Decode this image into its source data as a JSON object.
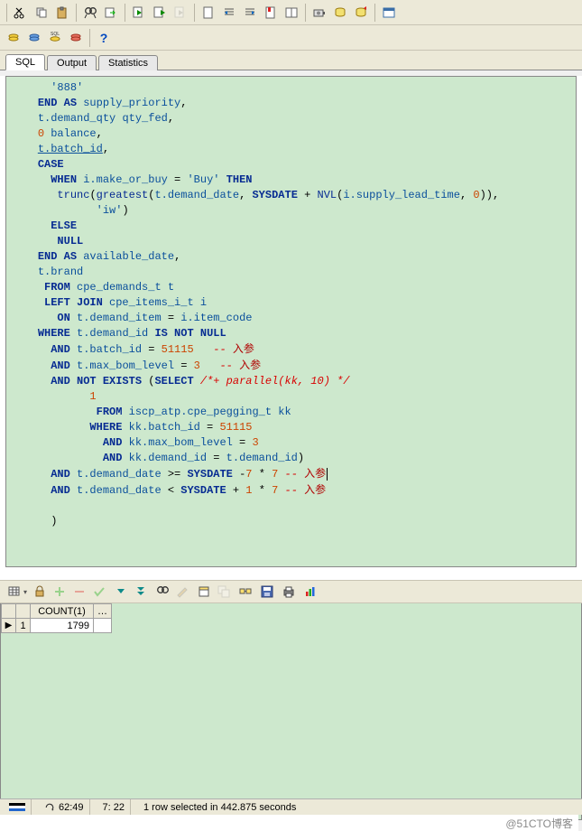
{
  "tabs": {
    "sql": "SQL",
    "output": "Output",
    "statistics": "Statistics"
  },
  "toolbar2": {
    "help_glyph": "?"
  },
  "sql_tokens": [
    {
      "indent": 6,
      "parts": [
        [
          "str",
          "'888'"
        ]
      ]
    },
    {
      "indent": 4,
      "parts": [
        [
          "kw",
          "END AS"
        ],
        [
          "txt",
          " "
        ],
        [
          "id",
          "supply_priority"
        ],
        [
          "txt",
          ","
        ]
      ]
    },
    {
      "indent": 4,
      "parts": [
        [
          "id",
          "t.demand_qty"
        ],
        [
          "txt",
          " "
        ],
        [
          "id",
          "qty_fed"
        ],
        [
          "txt",
          ","
        ]
      ]
    },
    {
      "indent": 4,
      "parts": [
        [
          "num",
          "0"
        ],
        [
          "txt",
          " "
        ],
        [
          "id",
          "balance"
        ],
        [
          "txt",
          ","
        ]
      ]
    },
    {
      "indent": 4,
      "parts": [
        [
          "id ul",
          "t.batch_id"
        ],
        [
          "txt",
          ","
        ]
      ]
    },
    {
      "indent": 4,
      "parts": [
        [
          "kw",
          "CASE"
        ]
      ]
    },
    {
      "indent": 6,
      "parts": [
        [
          "kw",
          "WHEN"
        ],
        [
          "txt",
          " "
        ],
        [
          "id",
          "i.make_or_buy"
        ],
        [
          "txt",
          " = "
        ],
        [
          "str",
          "'Buy'"
        ],
        [
          "txt",
          " "
        ],
        [
          "kw",
          "THEN"
        ]
      ]
    },
    {
      "indent": 7,
      "parts": [
        [
          "fn",
          "trunc"
        ],
        [
          "txt",
          "("
        ],
        [
          "fn",
          "greatest"
        ],
        [
          "txt",
          "("
        ],
        [
          "id",
          "t.demand_date"
        ],
        [
          "txt",
          ", "
        ],
        [
          "kw",
          "SYSDATE"
        ],
        [
          "txt",
          " + "
        ],
        [
          "fn",
          "NVL"
        ],
        [
          "txt",
          "("
        ],
        [
          "id",
          "i.supply_lead_time"
        ],
        [
          "txt",
          ", "
        ],
        [
          "num",
          "0"
        ],
        [
          "txt",
          ")),"
        ]
      ]
    },
    {
      "indent": 13,
      "parts": [
        [
          "str",
          "'iw'"
        ],
        [
          "txt",
          ")"
        ]
      ]
    },
    {
      "indent": 6,
      "parts": [
        [
          "kw",
          "ELSE"
        ]
      ]
    },
    {
      "indent": 7,
      "parts": [
        [
          "kw",
          "NULL"
        ]
      ]
    },
    {
      "indent": 4,
      "parts": [
        [
          "kw",
          "END AS"
        ],
        [
          "txt",
          " "
        ],
        [
          "id",
          "available_date"
        ],
        [
          "txt",
          ","
        ]
      ]
    },
    {
      "indent": 4,
      "parts": [
        [
          "id",
          "t.brand"
        ]
      ]
    },
    {
      "indent": 5,
      "parts": [
        [
          "kw",
          "FROM"
        ],
        [
          "txt",
          " "
        ],
        [
          "id",
          "cpe_demands_t"
        ],
        [
          "txt",
          " "
        ],
        [
          "id",
          "t"
        ]
      ]
    },
    {
      "indent": 5,
      "parts": [
        [
          "kw",
          "LEFT JOIN"
        ],
        [
          "txt",
          " "
        ],
        [
          "id",
          "cpe_items_i_t"
        ],
        [
          "txt",
          " "
        ],
        [
          "id",
          "i"
        ]
      ]
    },
    {
      "indent": 7,
      "parts": [
        [
          "kw",
          "ON"
        ],
        [
          "txt",
          " "
        ],
        [
          "id",
          "t.demand_item"
        ],
        [
          "txt",
          " = "
        ],
        [
          "id",
          "i.item_code"
        ]
      ]
    },
    {
      "indent": 4,
      "parts": [
        [
          "kw",
          "WHERE"
        ],
        [
          "txt",
          " "
        ],
        [
          "id",
          "t.demand_id"
        ],
        [
          "txt",
          " "
        ],
        [
          "kw",
          "IS NOT NULL"
        ]
      ]
    },
    {
      "indent": 6,
      "parts": [
        [
          "kw",
          "AND"
        ],
        [
          "txt",
          " "
        ],
        [
          "id",
          "t.batch_id"
        ],
        [
          "txt",
          " = "
        ],
        [
          "num",
          "51115"
        ],
        [
          "txt",
          "   "
        ],
        [
          "cmt",
          "-- "
        ],
        [
          "cmtcn",
          "入参"
        ]
      ]
    },
    {
      "indent": 6,
      "parts": [
        [
          "kw",
          "AND"
        ],
        [
          "txt",
          " "
        ],
        [
          "id",
          "t.max_bom_level"
        ],
        [
          "txt",
          " = "
        ],
        [
          "num",
          "3"
        ],
        [
          "txt",
          "   "
        ],
        [
          "cmt",
          "-- "
        ],
        [
          "cmtcn",
          "入参"
        ]
      ]
    },
    {
      "indent": 6,
      "parts": [
        [
          "kw",
          "AND NOT EXISTS"
        ],
        [
          "txt",
          " ("
        ],
        [
          "kw",
          "SELECT"
        ],
        [
          "txt",
          " "
        ],
        [
          "cmt",
          "/*+ parallel(kk, 10) */"
        ]
      ]
    },
    {
      "indent": 12,
      "parts": [
        [
          "num",
          "1"
        ]
      ]
    },
    {
      "indent": 13,
      "parts": [
        [
          "kw",
          "FROM"
        ],
        [
          "txt",
          " "
        ],
        [
          "id",
          "iscp_atp.cpe_pegging_t"
        ],
        [
          "txt",
          " "
        ],
        [
          "id",
          "kk"
        ]
      ]
    },
    {
      "indent": 12,
      "parts": [
        [
          "kw",
          "WHERE"
        ],
        [
          "txt",
          " "
        ],
        [
          "id",
          "kk.batch_id"
        ],
        [
          "txt",
          " = "
        ],
        [
          "num",
          "51115"
        ]
      ]
    },
    {
      "indent": 14,
      "parts": [
        [
          "kw",
          "AND"
        ],
        [
          "txt",
          " "
        ],
        [
          "id",
          "kk.max_bom_level"
        ],
        [
          "txt",
          " = "
        ],
        [
          "num",
          "3"
        ]
      ]
    },
    {
      "indent": 14,
      "parts": [
        [
          "kw",
          "AND"
        ],
        [
          "txt",
          " "
        ],
        [
          "id",
          "kk.demand_id"
        ],
        [
          "txt",
          " = "
        ],
        [
          "id",
          "t.demand_id"
        ],
        [
          "txt",
          ")"
        ]
      ]
    },
    {
      "indent": 6,
      "parts": [
        [
          "kw",
          "AND"
        ],
        [
          "txt",
          " "
        ],
        [
          "id",
          "t.demand_date"
        ],
        [
          "txt",
          " >= "
        ],
        [
          "kw",
          "SYSDATE"
        ],
        [
          "txt",
          " -"
        ],
        [
          "num",
          "7"
        ],
        [
          "txt",
          " * "
        ],
        [
          "num",
          "7"
        ],
        [
          "txt",
          " "
        ],
        [
          "cmt",
          "-- "
        ],
        [
          "cmtcn",
          "入参"
        ],
        [
          "caret",
          "|"
        ]
      ]
    },
    {
      "indent": 6,
      "parts": [
        [
          "kw",
          "AND"
        ],
        [
          "txt",
          " "
        ],
        [
          "id",
          "t.demand_date"
        ],
        [
          "txt",
          " < "
        ],
        [
          "kw",
          "SYSDATE"
        ],
        [
          "txt",
          " + "
        ],
        [
          "num",
          "1"
        ],
        [
          "txt",
          " * "
        ],
        [
          "num",
          "7"
        ],
        [
          "txt",
          " "
        ],
        [
          "cmt",
          "-- "
        ],
        [
          "cmtcn",
          "入参"
        ]
      ]
    },
    {
      "indent": 0,
      "parts": [
        [
          "txt",
          ""
        ]
      ]
    },
    {
      "indent": 6,
      "parts": [
        [
          "txt",
          ")"
        ]
      ]
    }
  ],
  "grid": {
    "columns": [
      "",
      "COUNT(1)",
      "…"
    ],
    "rows": [
      {
        "ptr": "▶",
        "n": "1",
        "cells": [
          "1799"
        ]
      }
    ]
  },
  "status": {
    "timer": "62:49",
    "pos": "7: 22",
    "msg": "1 row selected in 442.875 seconds"
  },
  "watermark": "@51CTO博客"
}
